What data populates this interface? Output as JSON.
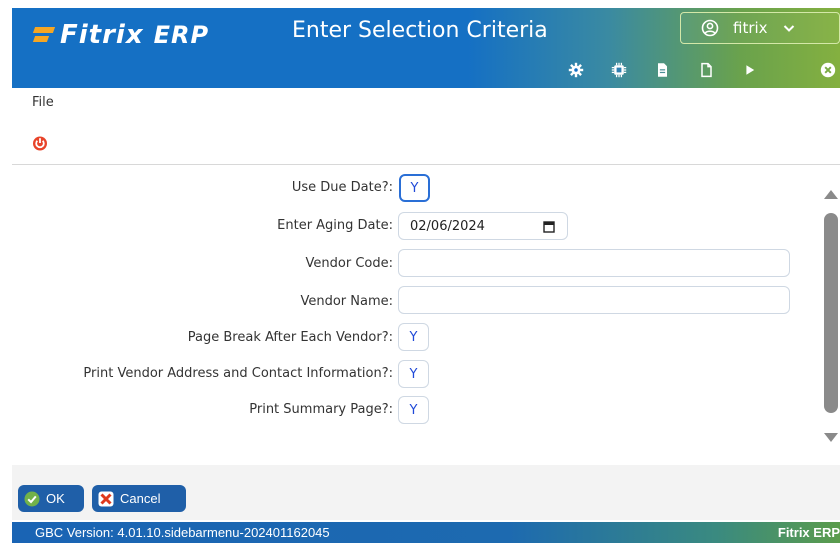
{
  "header": {
    "logo_text_1": "Fitrix",
    "logo_text_2": "ERP",
    "title": "Enter Selection Criteria",
    "user": "fitrix",
    "toolbar_icons": [
      "gear-icon",
      "chip-icon",
      "document-icon",
      "blank-document-icon",
      "play-icon",
      "close-circle-icon"
    ]
  },
  "menu": {
    "file_label": "File"
  },
  "form": {
    "use_due_date_label": "Use Due Date?:",
    "use_due_date_value": "Y",
    "aging_date_label": "Enter Aging Date:",
    "aging_date_value": "02/06/2024",
    "vendor_code_label": "Vendor Code:",
    "vendor_code_value": "",
    "vendor_name_label": "Vendor Name:",
    "vendor_name_value": "",
    "page_break_label": "Page Break After Each Vendor?:",
    "page_break_value": "Y",
    "print_address_label": "Print Vendor Address and Contact Information?:",
    "print_address_value": "Y",
    "print_summary_label": "Print Summary Page?:",
    "print_summary_value": "Y"
  },
  "buttons": {
    "ok_label": "OK",
    "cancel_label": "Cancel"
  },
  "status": {
    "version": "GBC Version: 4.01.10.sidebarmenu-202401162045",
    "brand": "Fitrix ERP"
  },
  "colors": {
    "header_blue": "#1570c4",
    "header_green": "#84b040",
    "button_blue": "#1f5fa8",
    "value_blue": "#1f49d8"
  }
}
